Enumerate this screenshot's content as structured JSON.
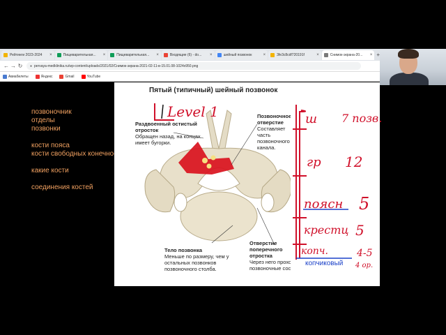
{
  "browser": {
    "tabs": [
      {
        "label": "Рейтинги 2023-2024",
        "icon_color": "#f2b400",
        "active": false
      },
      {
        "label": "Пищеварительная...",
        "icon_color": "#0f9d58",
        "active": false
      },
      {
        "label": "Пищеварительная...",
        "icon_color": "#0f9d58",
        "active": false
      },
      {
        "label": "Входящие (6) - do...",
        "icon_color": "#ea4335",
        "active": false
      },
      {
        "label": "шейный позвонок",
        "icon_color": "#4285f4",
        "active": false
      },
      {
        "label": "3fe3c8cdf720191f",
        "icon_color": "#f4b400",
        "active": false
      },
      {
        "label": "Снимок-экрана-20...",
        "icon_color": "#7a7a7a",
        "active": true
      }
    ],
    "new_tab_symbol": "+",
    "url": "pervaya-medklinika.ru/wp-content/uploads/2021/02/Снимок-экрана-2021-02-11-в-15.01.08-1024x950.png",
    "bookmarks": [
      {
        "label": "Авиабилеты",
        "icon_color": "#4a7bd0"
      },
      {
        "label": "Яндекс",
        "icon_color": "#e33"
      },
      {
        "label": "Gmail",
        "icon_color": "#ea4335"
      },
      {
        "label": "YouTube",
        "icon_color": "#ff0000"
      }
    ]
  },
  "slide": {
    "lines": [
      "позвоночник",
      "отделы",
      "позвонки",
      "",
      "кости пояса",
      "кости свободных конечностей",
      "",
      "какие кости",
      "",
      "соединения костей"
    ],
    "text_color": "#f0a060"
  },
  "image": {
    "title": "Пятый (типичный) шейный позвонок",
    "labels": {
      "spinous_title": "Раздвоенный остистый отросток",
      "spinous_body": "Обращен назад, на концах имеет бугорки.",
      "foramen_title": "Позвоночное отверстие",
      "foramen_body": "Составляет часть позвоночного канала.",
      "body_title": "Тело позвонка",
      "body_body": "Меньше по размеру, чем у остальных позвонков позвоночного столба.",
      "transverse_title": "Отверстие поперечного отростка",
      "transverse_body": "Через него проходят позвоночные сосуды."
    }
  },
  "handwriting": {
    "level_note": "Level 1",
    "counts": [
      {
        "section": "ш",
        "count": "7 позв."
      },
      {
        "section": "гр",
        "count": "12"
      },
      {
        "section": "поясн",
        "count": "5"
      },
      {
        "section": "крестц",
        "count": "5"
      },
      {
        "section": "копч.",
        "count": "4-5"
      }
    ],
    "coccyx_extra": "4 ор.",
    "typed_coccyx": "копчиковый",
    "ink_color": "#d0102a",
    "blue_ink": "#1a40c8"
  }
}
